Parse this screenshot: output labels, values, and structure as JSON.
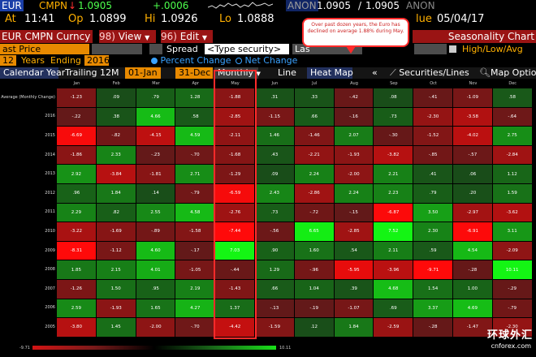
{
  "header": {
    "ticker": "EUR",
    "source": "CMPN",
    "last": "1.0905",
    "change": "+.0006",
    "at_label": "At",
    "time": "11:41",
    "op_label": "Op",
    "open": "1.0899",
    "hi_label": "Hi",
    "high": "1.0926",
    "lo_label": "Lo",
    "low": "1.0888",
    "quote_src": "ANON",
    "bid": "1.0905",
    "ask": "1.0905",
    "quote_src2": "ANON",
    "value_suffix": "lue",
    "date": "05/04/17",
    "arrow": "↓"
  },
  "toolbar": {
    "title": "EUR CMPN Curncy",
    "view_num": "98)",
    "view_label": "View",
    "edit_num": "96)",
    "edit_label": "Edit",
    "chart_title": "Seasonality Chart"
  },
  "inputs": {
    "field": "ast Price",
    "spread": "Spread",
    "type_security": "<Type security>",
    "last_short": "Las",
    "high_low_avg": "High/Low/Avg"
  },
  "period": {
    "years_count": "12",
    "years_label": "Years",
    "ending_label": "Ending",
    "ending_year": "2016",
    "percent_change": "Percent Change",
    "net_change": "Net Change"
  },
  "tabs": {
    "calendar_year": "Calendar Year",
    "trailing": "Trailing 12M",
    "from": "01-Jan",
    "to": "31-Dec",
    "monthly": "Monthly",
    "line": "Line",
    "heat_map": "Heat Map",
    "securities": "Securities/Lines",
    "map_options": "Map Options"
  },
  "grid": {
    "months": [
      "Jan",
      "Feb",
      "Mar",
      "Apr",
      "May",
      "Jun",
      "Jul",
      "Aug",
      "Sep",
      "Oct",
      "Nov",
      "Dec"
    ],
    "rows": [
      {
        "label": "Average (Monthly Change)",
        "values": [
          "-1.23",
          ".09",
          ".79",
          "1.28",
          "-1.88",
          ".31",
          ".33",
          "-.42",
          ".08",
          "-.41",
          "-1.09",
          ".58"
        ]
      },
      {
        "label": "2016",
        "values": [
          "-.22",
          ".38",
          "4.66",
          ".58",
          "-2.85",
          "-1.15",
          ".66",
          "-.16",
          ".73",
          "-2.30",
          "-3.58",
          "-.64"
        ]
      },
      {
        "label": "2015",
        "values": [
          "-6.69",
          "-.82",
          "-4.15",
          "4.59",
          "-2.11",
          "1.46",
          "-1.46",
          "2.07",
          "-.30",
          "-1.52",
          "-4.02",
          "2.75"
        ]
      },
      {
        "label": "2014",
        "values": [
          "-1.86",
          "2.33",
          "-.23",
          "-.70",
          "-1.68",
          ".43",
          "-2.21",
          "-1.93",
          "-3.82",
          "-.85",
          "-.57",
          "-2.84"
        ]
      },
      {
        "label": "2013",
        "values": [
          "2.92",
          "-3.84",
          "-1.81",
          "2.71",
          "-1.29",
          ".09",
          "2.24",
          "-2.00",
          "2.21",
          ".41",
          ".06",
          "1.12"
        ]
      },
      {
        "label": "2012",
        "values": [
          ".96",
          "1.84",
          ".14",
          "-.79",
          "-6.59",
          "2.43",
          "-2.86",
          "2.24",
          "2.23",
          ".79",
          ".20",
          "1.59"
        ]
      },
      {
        "label": "2011",
        "values": [
          "2.29",
          ".82",
          "2.55",
          "4.58",
          "-2.76",
          ".73",
          "-.72",
          "-.15",
          "-6.87",
          "3.50",
          "-2.97",
          "-3.62"
        ]
      },
      {
        "label": "2010",
        "values": [
          "-3.22",
          "-1.69",
          "-.89",
          "-1.58",
          "-7.44",
          "-.56",
          "6.65",
          "-2.85",
          "7.52",
          "2.30",
          "-6.91",
          "3.11"
        ]
      },
      {
        "label": "2009",
        "values": [
          "-8.31",
          "-1.12",
          "4.60",
          "-.17",
          "7.03",
          ".90",
          "1.60",
          ".54",
          "2.11",
          ".59",
          "4.54",
          "-2.09"
        ]
      },
      {
        "label": "2008",
        "values": [
          "1.85",
          "2.15",
          "4.01",
          "-1.05",
          "-.44",
          "1.29",
          "-.96",
          "-5.95",
          "-3.96",
          "-9.71",
          "-.28",
          "10.11"
        ]
      },
      {
        "label": "2007",
        "values": [
          "-1.26",
          "1.50",
          ".95",
          "2.19",
          "-1.43",
          ".66",
          "1.04",
          ".39",
          "4.68",
          "1.54",
          "1.00",
          "-.29"
        ]
      },
      {
        "label": "2006",
        "values": [
          "2.59",
          "-1.93",
          "1.65",
          "4.27",
          "1.37",
          "-.13",
          "-.19",
          "-1.07",
          ".69",
          "3.37",
          "4.69",
          "-.79"
        ]
      },
      {
        "label": "2005",
        "values": [
          "-3.80",
          "1.45",
          "-2.00",
          "-.70",
          "-4.42",
          "-1.59",
          ".12",
          "1.84",
          "-2.59",
          "-.28",
          "-1.47",
          "-2.30"
        ]
      }
    ]
  },
  "legend": {
    "min": "-9.71",
    "max": "10.11"
  },
  "callout": {
    "text": "Over past dozen years, the Euro has declined on average 1.88% during May."
  },
  "watermark": {
    "cn": "环球外汇",
    "url": "cnforex.com"
  },
  "colors": {
    "accent_orange": "#ffb000",
    "toolbar_red": "#9a1414",
    "highlight_red": "#ff2a2a",
    "tab_blue": "#23315e"
  }
}
